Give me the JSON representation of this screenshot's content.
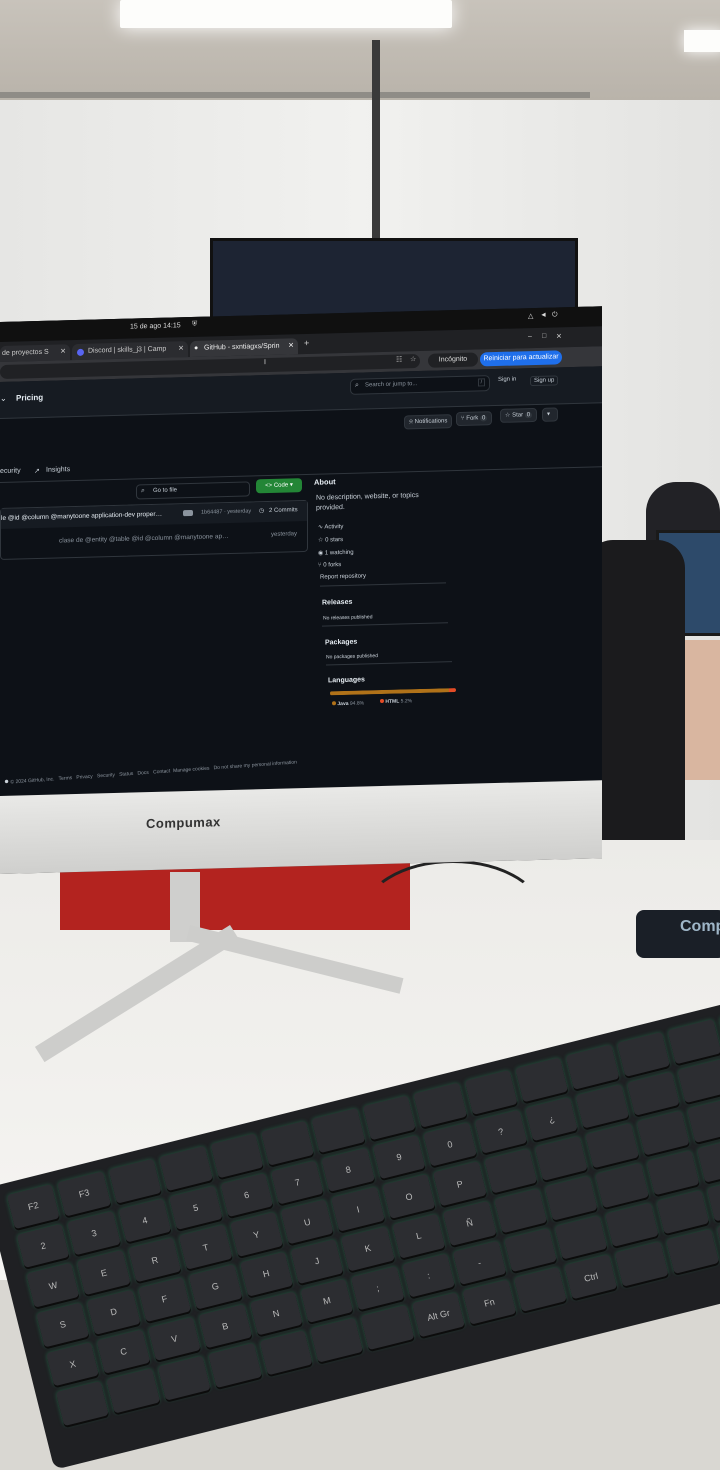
{
  "os_bar": {
    "datetime": "15 de ago  14:15"
  },
  "browser": {
    "tabs": [
      {
        "label": "de proyectos S"
      },
      {
        "label": "Discord | skills_j3 | Camp"
      },
      {
        "label": "GitHub - sxntiagxs/Sprin"
      }
    ],
    "new_tab": "+",
    "incognito_label": "Incógnito",
    "update_button": "Reiniciar para actualizar"
  },
  "github": {
    "nav_pricing": "Pricing",
    "search_placeholder": "Search or jump to...",
    "search_shortcut": "/",
    "sign_in": "Sign in",
    "sign_up": "Sign up",
    "notifications": "Notifications",
    "fork_label": "Fork",
    "fork_count": "0",
    "star_label": "Star",
    "star_count": "0",
    "tab_security": "ecurity",
    "tab_insights": "Insights",
    "go_to_file": "Go to file",
    "code_button": "Code",
    "latest_commit": {
      "message": "le @id @column @manytoone application-dev proper…",
      "hash": "1b64487 · yesterday",
      "commits": "2 Commits"
    },
    "file_row": {
      "message": "clase de @entity @table @id @column @manytoone ap…",
      "time": "yesterday"
    },
    "about": {
      "heading": "About",
      "description": "No description, website, or topics provided.",
      "activity": "Activity",
      "stars": "0 stars",
      "watching": "1 watching",
      "forks": "0 forks",
      "report": "Report repository"
    },
    "releases": {
      "heading": "Releases",
      "text": "No releases published"
    },
    "packages": {
      "heading": "Packages",
      "text": "No packages published"
    },
    "languages": {
      "heading": "Languages",
      "items": [
        {
          "name": "Java",
          "percent": "94.8%",
          "fraction": 0.948,
          "color": "#b07219"
        },
        {
          "name": "HTML",
          "percent": "5.2%",
          "fraction": 0.052,
          "color": "#e34c26"
        }
      ]
    },
    "footer": {
      "copyright": "© 2024 GitHub, Inc.",
      "links": [
        "Terms",
        "Privacy",
        "Security",
        "Status",
        "Docs",
        "Contact",
        "Manage cookies",
        "Do not share my personal information"
      ]
    }
  },
  "monitor_brand": "Compumax",
  "mousepad_text": "Comp",
  "keyboard_keys": [
    "F2",
    "F3",
    "",
    "",
    "",
    "",
    "",
    "",
    "",
    "",
    "",
    "",
    "",
    "",
    "",
    "2",
    "3",
    "4",
    "5",
    "6",
    "7",
    "8",
    "9",
    "0",
    "?",
    "¿",
    "",
    "",
    "",
    "",
    "W",
    "E",
    "R",
    "T",
    "Y",
    "U",
    "I",
    "O",
    "P",
    "",
    "",
    "",
    "",
    "",
    "",
    "S",
    "D",
    "F",
    "G",
    "H",
    "J",
    "K",
    "L",
    "Ñ",
    "",
    "",
    "",
    "",
    "",
    "",
    "X",
    "C",
    "V",
    "B",
    "N",
    "M",
    ";",
    ":",
    "-",
    "",
    "",
    "",
    "",
    "",
    "",
    "",
    "",
    "",
    "",
    "",
    "",
    "",
    "Alt Gr",
    "Fn",
    "",
    "Ctrl",
    "",
    "",
    ""
  ]
}
